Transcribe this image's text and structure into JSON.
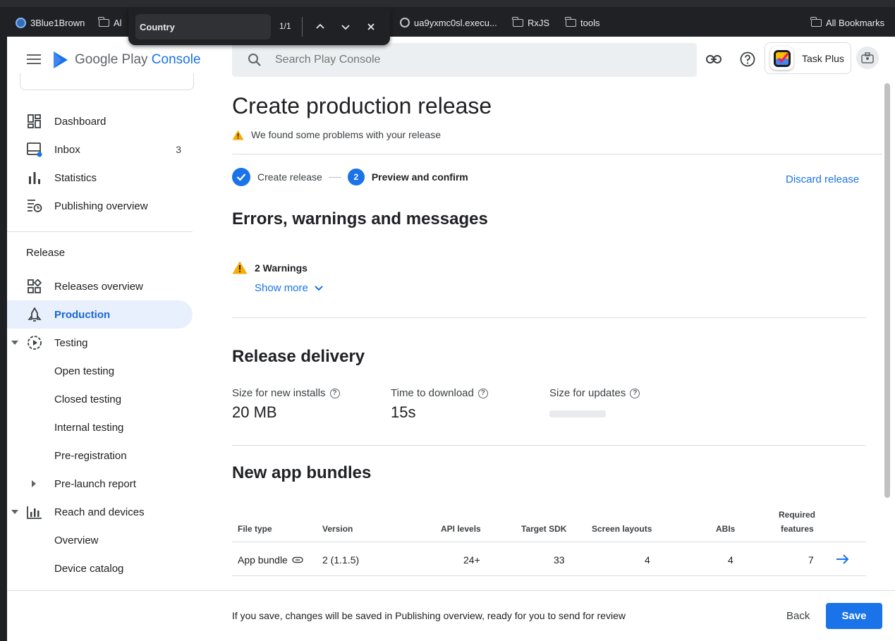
{
  "find_bar": {
    "query": "Country",
    "count": "1/1"
  },
  "bookmarks": [
    {
      "label": "3Blue1Brown",
      "icon": "channel-icon"
    },
    {
      "label": "Al",
      "icon": "folder-icon"
    },
    {
      "label": "ua9yxmc0sl.execu...",
      "icon": "globe-icon"
    },
    {
      "label": "RxJS",
      "icon": "folder-icon"
    },
    {
      "label": "tools",
      "icon": "folder-icon"
    },
    {
      "label": "All Bookmarks",
      "icon": "folder-icon"
    }
  ],
  "header": {
    "logo_google_play": "Google Play",
    "logo_console": "Console",
    "search_placeholder": "Search Play Console",
    "app_name": "Task Plus"
  },
  "sidebar": {
    "top_items": [
      {
        "label": "Dashboard",
        "icon": "dashboard-icon"
      },
      {
        "label": "Inbox",
        "icon": "inbox-icon",
        "badge": "3"
      },
      {
        "label": "Statistics",
        "icon": "bar-chart-icon"
      },
      {
        "label": "Publishing overview",
        "icon": "publishing-icon"
      }
    ],
    "section_release": "Release",
    "release_items": [
      {
        "label": "Releases overview",
        "icon": "releases-icon"
      },
      {
        "label": "Production",
        "icon": "production-icon",
        "active": true
      },
      {
        "label": "Testing",
        "icon": "testing-icon"
      },
      {
        "label": "Open testing"
      },
      {
        "label": "Closed testing"
      },
      {
        "label": "Internal testing"
      },
      {
        "label": "Pre-registration"
      },
      {
        "label": "Pre-launch report"
      },
      {
        "label": "Reach and devices",
        "icon": "reach-icon"
      },
      {
        "label": "Overview"
      },
      {
        "label": "Device catalog"
      }
    ]
  },
  "main": {
    "title": "Create production release",
    "problem_text": "We found some problems with your release",
    "steps": [
      {
        "label": "Create release",
        "state": "done"
      },
      {
        "number": "2",
        "label": "Preview and confirm",
        "state": "current"
      }
    ],
    "discard_label": "Discard release",
    "errors_heading": "Errors, warnings and messages",
    "warnings_label": "2 Warnings",
    "show_more_label": "Show more",
    "delivery_heading": "Release delivery",
    "metrics": [
      {
        "label": "Size for new installs",
        "value": "20 MB"
      },
      {
        "label": "Time to download",
        "value": "15s"
      },
      {
        "label": "Size for updates",
        "value": ""
      }
    ],
    "bundles_heading": "New app bundles",
    "table": {
      "headers": {
        "file_type": "File type",
        "version": "Version",
        "api_levels": "API levels",
        "target_sdk": "Target SDK",
        "screen_layouts": "Screen layouts",
        "abis": "ABIs",
        "required_features_1": "Required",
        "required_features_2": "features"
      },
      "rows": [
        {
          "file_type": "App bundle",
          "version": "2 (1.1.5)",
          "api_levels": "24+",
          "target_sdk": "33",
          "screen_layouts": "4",
          "abis": "4",
          "required_features": "7"
        }
      ]
    }
  },
  "footer": {
    "message": "If you save, changes will be saved in Publishing overview, ready for you to send for review",
    "back_label": "Back",
    "save_label": "Save"
  },
  "colors": {
    "accent": "#1a73e8",
    "warning": "#f9ab00",
    "active_nav_bg": "#e8f0fe"
  }
}
